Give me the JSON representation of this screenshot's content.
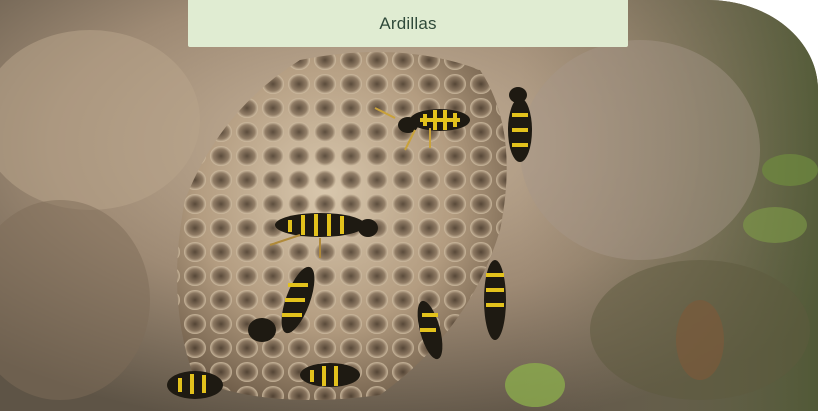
{
  "card": {
    "title": "Ardillas",
    "image_subject": "wasp-nest-photo"
  },
  "colors": {
    "label_background": "#e0ecd2",
    "label_text": "#2f4a3a",
    "page_background": "#ffffff"
  }
}
